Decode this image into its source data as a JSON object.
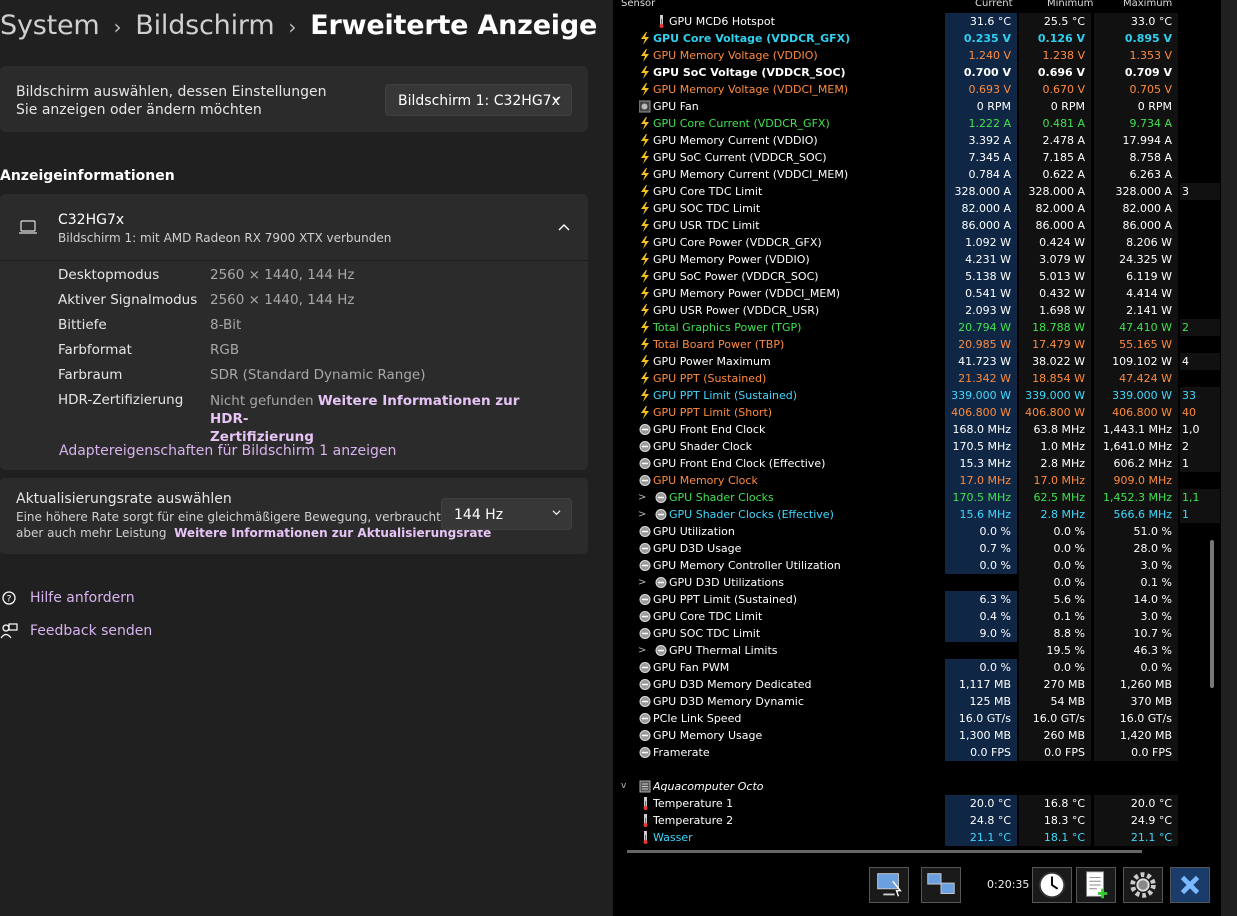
{
  "breadcrumb": {
    "item1": "System",
    "item2": "Bildschirm",
    "current": "Erweiterte Anzeige"
  },
  "display_select": {
    "label": "Bildschirm auswählen, dessen Einstellungen Sie anzeigen oder ändern möchten",
    "value": "Bildschirm 1: C32HG7x"
  },
  "info_header": "Anzeigeinformationen",
  "monitor": {
    "name": "C32HG7x",
    "desc": "Bildschirm 1: mit AMD Radeon RX 7900 XTX verbunden"
  },
  "props": [
    {
      "label": "Desktopmodus",
      "value": "2560 × 1440, 144 Hz"
    },
    {
      "label": "Aktiver Signalmodus",
      "value": "2560 × 1440, 144 Hz"
    },
    {
      "label": "Bittiefe",
      "value": "8-Bit"
    },
    {
      "label": "Farbformat",
      "value": "RGB"
    },
    {
      "label": "Farbraum",
      "value": "SDR (Standard Dynamic Range)"
    },
    {
      "label": "HDR-Zertifizierung",
      "value": "Nicht gefunden",
      "link1": "Weitere Informationen zur HDR-",
      "link2": "Zertifizierung"
    }
  ],
  "adapter_link": "Adaptereigenschaften für Bildschirm 1 anzeigen",
  "refresh": {
    "title": "Aktualisierungsrate auswählen",
    "desc1": "Eine höhere Rate sorgt für eine gleichmäßigere Bewegung, verbraucht",
    "desc2": "aber auch mehr Leistung",
    "link": "Weitere Informationen zur Aktualisierungsrate",
    "value": "144 Hz"
  },
  "help": {
    "help_label": "Hilfe anfordern",
    "feedback_label": "Feedback senden"
  },
  "hwinfo": {
    "columns": {
      "sensor": "Sensor",
      "current": "Current",
      "min": "Minimum",
      "max": "Maximum"
    },
    "clock": "0:20:35",
    "rows": [
      {
        "n": "GPU MCD6 Hotspot",
        "c": "31.6 °C",
        "mi": "25.5 °C",
        "ma": "33.0 °C",
        "x": "",
        "col": "w",
        "icon": "temp",
        "ind": 1
      },
      {
        "n": "GPU Core Voltage (VDDCR_GFX)",
        "c": "0.235 V",
        "mi": "0.126 V",
        "ma": "0.895 V",
        "x": "",
        "col": "cy",
        "b": 1,
        "icon": "bolt"
      },
      {
        "n": "GPU Memory Voltage (VDDIO)",
        "c": "1.240 V",
        "mi": "1.238 V",
        "ma": "1.353 V",
        "x": "",
        "col": "or",
        "icon": "bolt"
      },
      {
        "n": "GPU SoC Voltage (VDDCR_SOC)",
        "c": "0.700 V",
        "mi": "0.696 V",
        "ma": "0.709 V",
        "x": "",
        "col": "w",
        "b": 1,
        "icon": "bolt"
      },
      {
        "n": "GPU Memory Voltage (VDDCI_MEM)",
        "c": "0.693 V",
        "mi": "0.670 V",
        "ma": "0.705 V",
        "x": "",
        "col": "or",
        "icon": "bolt"
      },
      {
        "n": "GPU Fan",
        "c": "0 RPM",
        "mi": "0 RPM",
        "ma": "0 RPM",
        "x": "",
        "col": "w",
        "icon": "fan"
      },
      {
        "n": "GPU Core Current (VDDCR_GFX)",
        "c": "1.222 A",
        "mi": "0.481 A",
        "ma": "9.734 A",
        "x": "",
        "col": "gr",
        "icon": "bolt"
      },
      {
        "n": "GPU Memory Current (VDDIO)",
        "c": "3.392 A",
        "mi": "2.478 A",
        "ma": "17.994 A",
        "x": "",
        "col": "w",
        "icon": "bolt"
      },
      {
        "n": "GPU SoC Current (VDDCR_SOC)",
        "c": "7.345 A",
        "mi": "7.185 A",
        "ma": "8.758 A",
        "x": "",
        "col": "w",
        "icon": "bolt"
      },
      {
        "n": "GPU Memory Current (VDDCI_MEM)",
        "c": "0.784 A",
        "mi": "0.622 A",
        "ma": "6.263 A",
        "x": "",
        "col": "w",
        "icon": "bolt"
      },
      {
        "n": "GPU Core TDC Limit",
        "c": "328.000 A",
        "mi": "328.000 A",
        "ma": "328.000 A",
        "x": "3",
        "col": "w",
        "icon": "bolt"
      },
      {
        "n": "GPU SOC TDC Limit",
        "c": "82.000 A",
        "mi": "82.000 A",
        "ma": "82.000 A",
        "x": "",
        "col": "w",
        "icon": "bolt"
      },
      {
        "n": "GPU USR TDC Limit",
        "c": "86.000 A",
        "mi": "86.000 A",
        "ma": "86.000 A",
        "x": "",
        "col": "w",
        "icon": "bolt"
      },
      {
        "n": "GPU Core Power (VDDCR_GFX)",
        "c": "1.092 W",
        "mi": "0.424 W",
        "ma": "8.206 W",
        "x": "",
        "col": "w",
        "icon": "bolt"
      },
      {
        "n": "GPU Memory Power (VDDIO)",
        "c": "4.231 W",
        "mi": "3.079 W",
        "ma": "24.325 W",
        "x": "",
        "col": "w",
        "icon": "bolt"
      },
      {
        "n": "GPU SoC Power (VDDCR_SOC)",
        "c": "5.138 W",
        "mi": "5.013 W",
        "ma": "6.119 W",
        "x": "",
        "col": "w",
        "icon": "bolt"
      },
      {
        "n": "GPU Memory Power (VDDCI_MEM)",
        "c": "0.541 W",
        "mi": "0.432 W",
        "ma": "4.414 W",
        "x": "",
        "col": "w",
        "icon": "bolt"
      },
      {
        "n": "GPU USR Power (VDDCR_USR)",
        "c": "2.093 W",
        "mi": "1.698 W",
        "ma": "2.141 W",
        "x": "",
        "col": "w",
        "icon": "bolt"
      },
      {
        "n": "Total Graphics Power (TGP)",
        "c": "20.794 W",
        "mi": "18.788 W",
        "ma": "47.410 W",
        "x": "2",
        "col": "gr",
        "icon": "bolt"
      },
      {
        "n": "Total Board Power (TBP)",
        "c": "20.985 W",
        "mi": "17.479 W",
        "ma": "55.165 W",
        "x": "",
        "col": "or",
        "icon": "bolt"
      },
      {
        "n": "GPU Power Maximum",
        "c": "41.723 W",
        "mi": "38.022 W",
        "ma": "109.102 W",
        "x": "4",
        "col": "w",
        "icon": "bolt"
      },
      {
        "n": "GPU PPT (Sustained)",
        "c": "21.342 W",
        "mi": "18.854 W",
        "ma": "47.424 W",
        "x": "",
        "col": "or",
        "icon": "bolt"
      },
      {
        "n": "GPU PPT Limit (Sustained)",
        "c": "339.000 W",
        "mi": "339.000 W",
        "ma": "339.000 W",
        "x": "33",
        "col": "lc",
        "icon": "bolt"
      },
      {
        "n": "GPU PPT Limit (Short)",
        "c": "406.800 W",
        "mi": "406.800 W",
        "ma": "406.800 W",
        "x": "40",
        "col": "or",
        "icon": "bolt"
      },
      {
        "n": "GPU Front End Clock",
        "c": "168.0 MHz",
        "mi": "63.8 MHz",
        "ma": "1,443.1 MHz",
        "x": "1,0",
        "col": "w",
        "icon": "clk"
      },
      {
        "n": "GPU Shader Clock",
        "c": "170.5 MHz",
        "mi": "1.0 MHz",
        "ma": "1,641.0 MHz",
        "x": "2",
        "col": "w",
        "icon": "clk"
      },
      {
        "n": "GPU Front End Clock (Effective)",
        "c": "15.3 MHz",
        "mi": "2.8 MHz",
        "ma": "606.2 MHz",
        "x": "1",
        "col": "w",
        "icon": "clk"
      },
      {
        "n": "GPU Memory Clock",
        "c": "17.0 MHz",
        "mi": "17.0 MHz",
        "ma": "909.0 MHz",
        "x": "",
        "col": "or",
        "icon": "clk"
      },
      {
        "n": "GPU Shader Clocks",
        "c": "170.5 MHz",
        "mi": "62.5 MHz",
        "ma": "1,452.3 MHz",
        "x": "1,1",
        "col": "gr",
        "icon": "clk",
        "ind": 1,
        "exp": 1
      },
      {
        "n": "GPU Shader Clocks (Effective)",
        "c": "15.6 MHz",
        "mi": "2.8 MHz",
        "ma": "566.6 MHz",
        "x": "1",
        "col": "lc",
        "icon": "clk",
        "ind": 1,
        "exp": 1
      },
      {
        "n": "GPU Utilization",
        "c": "0.0 %",
        "mi": "0.0 %",
        "ma": "51.0 %",
        "x": "",
        "col": "w",
        "icon": "clk"
      },
      {
        "n": "GPU D3D Usage",
        "c": "0.7 %",
        "mi": "0.0 %",
        "ma": "28.0 %",
        "x": "",
        "col": "w",
        "icon": "clk"
      },
      {
        "n": "GPU Memory Controller Utilization",
        "c": "0.0 %",
        "mi": "0.0 %",
        "ma": "3.0 %",
        "x": "",
        "col": "w",
        "icon": "clk"
      },
      {
        "n": "GPU D3D Utilizations",
        "c": "",
        "mi": "0.0 %",
        "ma": "0.1 %",
        "x": "",
        "col": "w",
        "icon": "clk",
        "ind": 1,
        "exp": 1
      },
      {
        "n": "GPU PPT Limit (Sustained)",
        "c": "6.3 %",
        "mi": "5.6 %",
        "ma": "14.0 %",
        "x": "",
        "col": "w",
        "icon": "clk"
      },
      {
        "n": "GPU Core TDC Limit",
        "c": "0.4 %",
        "mi": "0.1 %",
        "ma": "3.0 %",
        "x": "",
        "col": "w",
        "icon": "clk"
      },
      {
        "n": "GPU SOC TDC Limit",
        "c": "9.0 %",
        "mi": "8.8 %",
        "ma": "10.7 %",
        "x": "",
        "col": "w",
        "icon": "clk"
      },
      {
        "n": "GPU Thermal Limits",
        "c": "",
        "mi": "19.5 %",
        "ma": "46.3 %",
        "x": "",
        "col": "w",
        "icon": "clk",
        "ind": 1,
        "exp": 1
      },
      {
        "n": "GPU Fan PWM",
        "c": "0.0 %",
        "mi": "0.0 %",
        "ma": "0.0 %",
        "x": "",
        "col": "w",
        "icon": "clk"
      },
      {
        "n": "GPU D3D Memory Dedicated",
        "c": "1,117 MB",
        "mi": "270 MB",
        "ma": "1,260 MB",
        "x": "",
        "col": "w",
        "icon": "clk"
      },
      {
        "n": "GPU D3D Memory Dynamic",
        "c": "125 MB",
        "mi": "54 MB",
        "ma": "370 MB",
        "x": "",
        "col": "w",
        "icon": "clk"
      },
      {
        "n": "PCIe Link Speed",
        "c": "16.0 GT/s",
        "mi": "16.0 GT/s",
        "ma": "16.0 GT/s",
        "x": "",
        "col": "w",
        "icon": "clk"
      },
      {
        "n": "GPU Memory Usage",
        "c": "1,300 MB",
        "mi": "260 MB",
        "ma": "1,420 MB",
        "x": "",
        "col": "w",
        "icon": "clk"
      },
      {
        "n": "Framerate",
        "c": "0.0 FPS",
        "mi": "0.0 FPS",
        "ma": "0.0 FPS",
        "x": "",
        "col": "w",
        "icon": "clk"
      },
      {
        "n": "",
        "c": "",
        "mi": "",
        "ma": "",
        "x": "",
        "col": "w",
        "icon": "none"
      },
      {
        "n": "Aquacomputer Octo",
        "c": "",
        "mi": "",
        "ma": "",
        "x": "",
        "col": "w",
        "icon": "dev",
        "group": 1
      },
      {
        "n": "Temperature 1",
        "c": "20.0 °C",
        "mi": "16.8 °C",
        "ma": "20.0 °C",
        "x": "",
        "col": "w",
        "icon": "temp"
      },
      {
        "n": "Temperature 2",
        "c": "24.8 °C",
        "mi": "18.3 °C",
        "ma": "24.9 °C",
        "x": "",
        "col": "w",
        "icon": "temp"
      },
      {
        "n": "Wasser",
        "c": "21.1 °C",
        "mi": "18.1 °C",
        "ma": "21.1 °C",
        "x": "",
        "col": "lc",
        "icon": "temp"
      }
    ]
  }
}
